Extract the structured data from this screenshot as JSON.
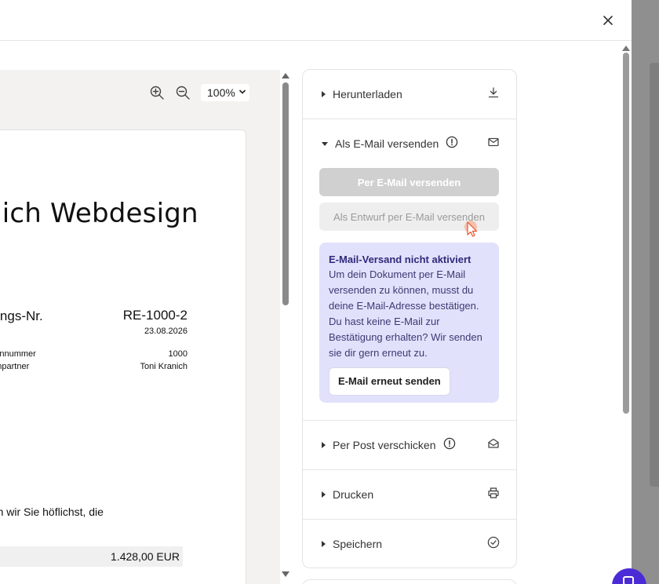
{
  "document": {
    "title": "nich Webdesign",
    "invoice_label": "nungs-Nr.",
    "invoice_number": "RE-1000-2",
    "date": "23.08.2026",
    "rows": [
      {
        "label": "ndennummer",
        "value": "1000"
      },
      {
        "label": "rechpartner",
        "value": "Toni Kranich"
      }
    ],
    "body_text": "tten wir Sie höflichst, die",
    "total": "1.428,00 EUR"
  },
  "zoom": {
    "level": "100%"
  },
  "panel": {
    "download": {
      "label": "Herunterladen",
      "icon": "download-icon"
    },
    "email": {
      "label": "Als E-Mail versenden",
      "send_button": "Per E-Mail versenden",
      "draft_button": "Als Entwurf per E-Mail versenden",
      "notice_title": "E-Mail-Versand nicht aktiviert",
      "notice_text": "Um dein Dokument per E-Mail versenden zu können, musst du deine E-Mail-Adresse bestätigen. Du hast keine E-Mail zur Bestätigung erhalten? Wir senden sie dir gern erneut zu.",
      "resend_button": "E-Mail erneut senden"
    },
    "post": {
      "label": "Per Post verschicken"
    },
    "print": {
      "label": "Drucken"
    },
    "save": {
      "label": "Speichern"
    }
  },
  "colors": {
    "notice_bg": "#e2e1fc",
    "notice_title": "#2f2a7a",
    "chat_bubble": "#4b2bd6"
  }
}
